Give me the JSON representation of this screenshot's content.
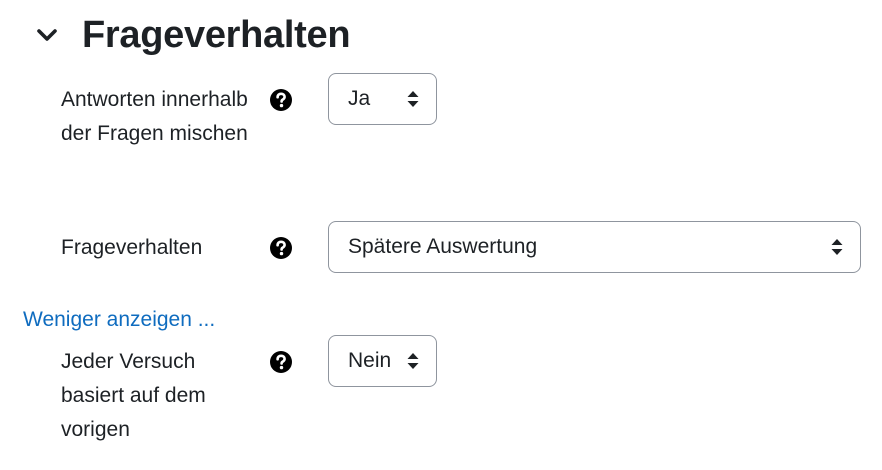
{
  "section": {
    "title": "Frageverhalten",
    "expand_icon": "chevron-down-icon"
  },
  "fields": [
    {
      "label": "Antworten innerhalb der Fragen mischen",
      "help_icon": "question-circle-icon",
      "value": "Ja",
      "caret_icon": "sort-caret-icon"
    },
    {
      "label": "Frageverhalten",
      "help_icon": "question-circle-icon",
      "value": "Spätere Auswertung",
      "caret_icon": "sort-caret-icon"
    },
    {
      "label": "Jeder Versuch basiert auf dem vorigen",
      "help_icon": "question-circle-icon",
      "value": "Nein",
      "caret_icon": "sort-caret-icon"
    }
  ],
  "show_less_link": "Weniger anzeigen ...",
  "colors": {
    "text": "#1d2125",
    "link": "#0f6cbf",
    "border": "#8f959e"
  }
}
